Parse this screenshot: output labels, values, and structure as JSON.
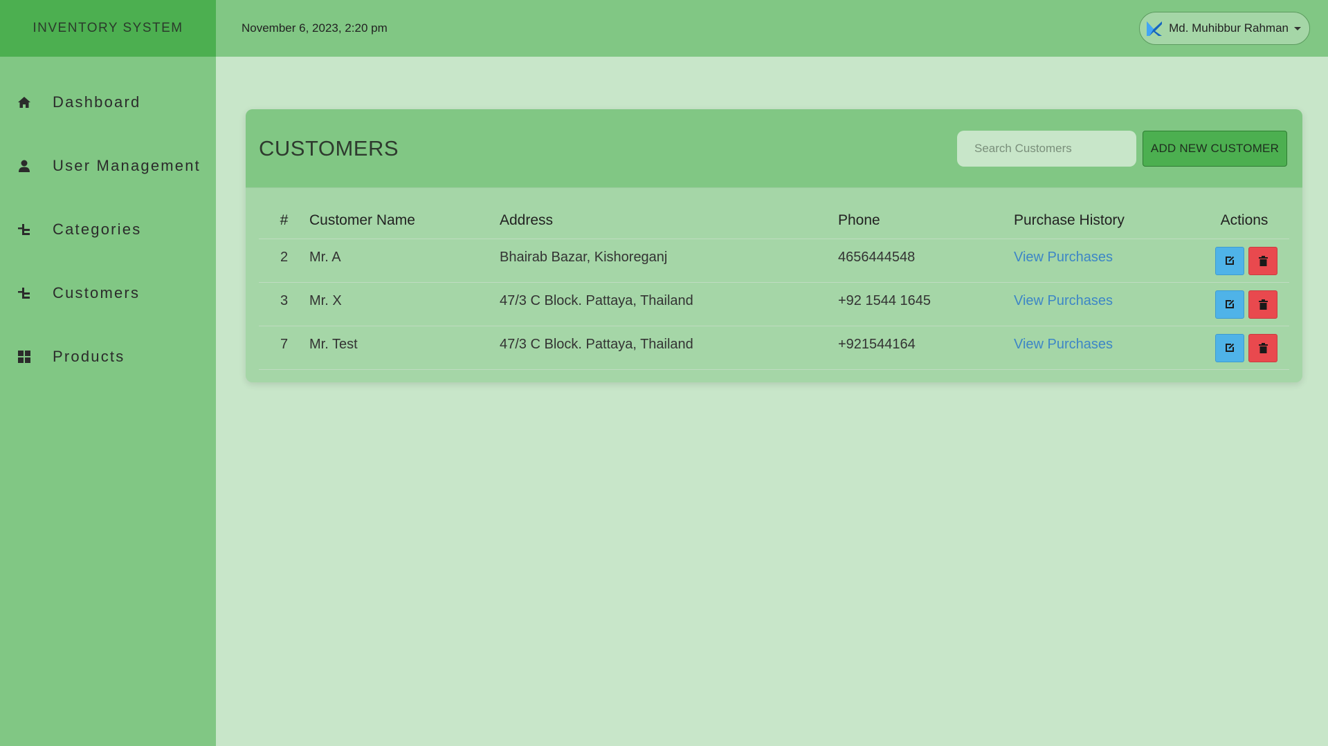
{
  "brand": "INVENTORY SYSTEM",
  "header": {
    "datetime": "November 6, 2023, 2:20 pm",
    "user_name": "Md. Muhibbur Rahman"
  },
  "sidebar": {
    "items": [
      {
        "label": "Dashboard",
        "icon": "home-icon"
      },
      {
        "label": "User Management",
        "icon": "user-icon"
      },
      {
        "label": "Categories",
        "icon": "hierarchy-icon"
      },
      {
        "label": "Customers",
        "icon": "hierarchy-icon"
      },
      {
        "label": "Products",
        "icon": "grid-icon"
      }
    ]
  },
  "panel": {
    "title": "CUSTOMERS",
    "search_placeholder": "Search Customers",
    "add_button": "ADD NEW CUSTOMER"
  },
  "table": {
    "headers": [
      "#",
      "Customer Name",
      "Address",
      "Phone",
      "Purchase History",
      "Actions"
    ],
    "rows": [
      {
        "id": "2",
        "name": "Mr. A",
        "address": "Bhairab Bazar, Kishoreganj",
        "phone": "4656444548",
        "history": "View Purchases"
      },
      {
        "id": "3",
        "name": "Mr. X",
        "address": "47/3 C Block. Pattaya, Thailand",
        "phone": "+92 1544 1645",
        "history": "View Purchases"
      },
      {
        "id": "7",
        "name": "Mr. Test",
        "address": "47/3 C Block. Pattaya, Thailand",
        "phone": "+921544164",
        "history": "View Purchases"
      }
    ]
  },
  "colors": {
    "sidebar": "#81c784",
    "brand_bar": "#4caf50",
    "background": "#c8e6c9",
    "panel": "#a5d6a7",
    "link": "#3d86c6",
    "edit": "#4fb3e8",
    "delete": "#e9494e"
  }
}
